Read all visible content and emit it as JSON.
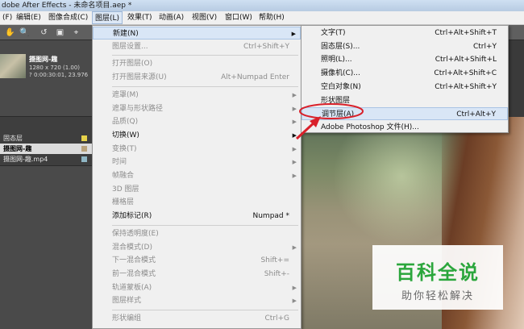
{
  "window": {
    "title": "dobe After Effects - 未命名项目.aep *"
  },
  "menubar": {
    "items": [
      "(F)",
      "编辑(E)",
      "图像合成(C)",
      "图层(L)",
      "效果(T)",
      "动画(A)",
      "视图(V)",
      "窗口(W)",
      "帮助(H)"
    ],
    "active": "图层(L)"
  },
  "project": {
    "name": "摄图网-趣",
    "info_lines": [
      "1280 x 720 (1.00)",
      "? 0:00:30:01, 23.976"
    ],
    "items": [
      {
        "label": "固态层",
        "color": "#e6d24a"
      },
      {
        "label": "摄图网-趣",
        "color": "#b9a27a",
        "selected": true
      },
      {
        "label": "摄图网-趣.mp4",
        "color": "#8fb6c4"
      }
    ]
  },
  "layer_menu": [
    {
      "label": "新建(N)",
      "shortcut": "",
      "submenu": true,
      "enabled": true,
      "highlighted": true
    },
    {
      "label": "图层设置...",
      "shortcut": "Ctrl+Shift+Y",
      "enabled": false
    },
    {
      "sep": true
    },
    {
      "label": "打开图层(O)",
      "shortcut": "",
      "enabled": false
    },
    {
      "label": "打开图层来源(U)",
      "shortcut": "Alt+Numpad Enter",
      "enabled": false
    },
    {
      "sep": true
    },
    {
      "label": "遮罩(M)",
      "submenu": true,
      "enabled": false
    },
    {
      "label": "遮罩与形状路径",
      "submenu": true,
      "enabled": false
    },
    {
      "label": "品质(Q)",
      "submenu": true,
      "enabled": false
    },
    {
      "label": "切换(W)",
      "submenu": true,
      "enabled": true
    },
    {
      "label": "变换(T)",
      "submenu": true,
      "enabled": false
    },
    {
      "label": "时间",
      "submenu": true,
      "enabled": false
    },
    {
      "label": "帧融合",
      "submenu": true,
      "enabled": false
    },
    {
      "label": "3D 图层",
      "enabled": false
    },
    {
      "label": "栅格层",
      "enabled": false
    },
    {
      "label": "添加标记(R)",
      "shortcut": "Numpad *",
      "enabled": true
    },
    {
      "sep": true
    },
    {
      "label": "保持透明度(E)",
      "enabled": false
    },
    {
      "label": "混合模式(D)",
      "submenu": true,
      "enabled": false
    },
    {
      "label": "下一混合模式",
      "shortcut": "Shift+=",
      "enabled": false
    },
    {
      "label": "前一混合模式",
      "shortcut": "Shift+-",
      "enabled": false
    },
    {
      "label": "轨道蒙板(A)",
      "submenu": true,
      "enabled": false
    },
    {
      "label": "图层样式",
      "submenu": true,
      "enabled": false
    },
    {
      "sep": true
    },
    {
      "label": "形状编组",
      "shortcut": "Ctrl+G",
      "enabled": false
    }
  ],
  "new_submenu": [
    {
      "label": "文字(T)",
      "shortcut": "Ctrl+Alt+Shift+T"
    },
    {
      "label": "固态层(S)...",
      "shortcut": "Ctrl+Y"
    },
    {
      "label": "照明(L)...",
      "shortcut": "Ctrl+Alt+Shift+L"
    },
    {
      "label": "摄像机(C)...",
      "shortcut": "Ctrl+Alt+Shift+C"
    },
    {
      "label": "空白对象(N)",
      "shortcut": "Ctrl+Alt+Shift+Y"
    },
    {
      "label": "形状图层",
      "shortcut": ""
    },
    {
      "label": "调节层(A)",
      "shortcut": "Ctrl+Alt+Y",
      "highlighted": true
    },
    {
      "label": "Adobe Photoshop 文件(H)...",
      "shortcut": ""
    }
  ],
  "watermark": {
    "title": "百科全说",
    "subtitle": "助你轻松解决"
  },
  "colors": {
    "callout": "#d9202a",
    "menu_bg": "#f0f0f0",
    "highlight": "#d9e6f6"
  }
}
